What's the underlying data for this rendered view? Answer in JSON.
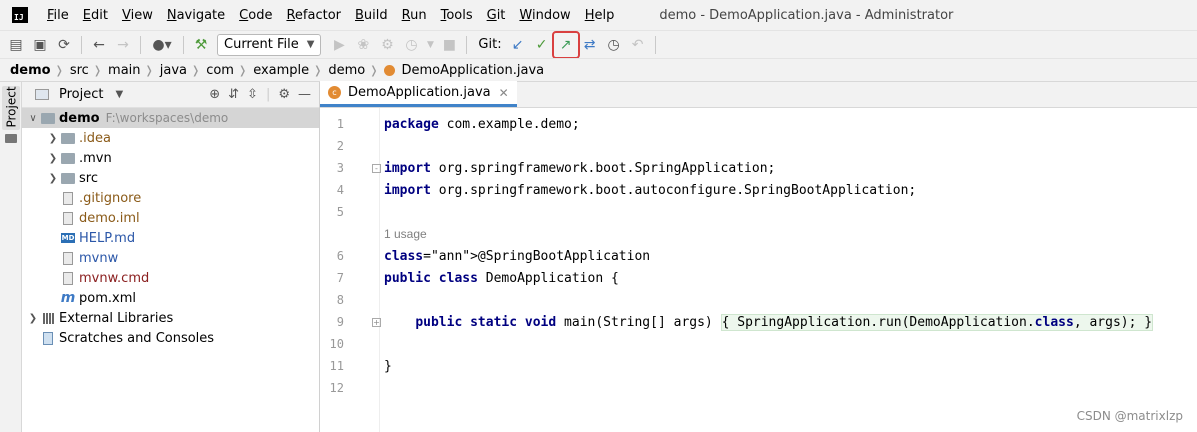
{
  "window": {
    "title": "demo - DemoApplication.java - Administrator"
  },
  "menu": [
    "File",
    "Edit",
    "View",
    "Navigate",
    "Code",
    "Refactor",
    "Build",
    "Run",
    "Tools",
    "Git",
    "Window",
    "Help"
  ],
  "toolbar": {
    "run_config": "Current File",
    "git_label": "Git:"
  },
  "breadcrumbs": [
    "demo",
    "src",
    "main",
    "java",
    "com",
    "example",
    "demo",
    "DemoApplication.java"
  ],
  "side_tabs": {
    "project": "Project"
  },
  "project_panel": {
    "title": "Project",
    "tree": [
      {
        "label": "demo",
        "path": "F:\\workspaces\\demo",
        "level": 0,
        "expanded": true,
        "bold": true,
        "icon": "module-folder"
      },
      {
        "label": ".idea",
        "level": 1,
        "collapsed": true,
        "icon": "folder",
        "color": "#8a5a18"
      },
      {
        "label": ".mvn",
        "level": 1,
        "collapsed": true,
        "icon": "folder",
        "color": "#000000"
      },
      {
        "label": "src",
        "level": 1,
        "collapsed": true,
        "icon": "folder",
        "color": "#000000"
      },
      {
        "label": ".gitignore",
        "level": 1,
        "icon": "file",
        "color": "#8a5a18"
      },
      {
        "label": "demo.iml",
        "level": 1,
        "icon": "file",
        "color": "#8a5a18"
      },
      {
        "label": "HELP.md",
        "level": 1,
        "icon": "md",
        "color": "#2b57a8"
      },
      {
        "label": "mvnw",
        "level": 1,
        "icon": "file",
        "color": "#2b57a8"
      },
      {
        "label": "mvnw.cmd",
        "level": 1,
        "icon": "file",
        "color": "#8b2020"
      },
      {
        "label": "pom.xml",
        "level": 1,
        "icon": "maven",
        "color": "#000000"
      },
      {
        "label": "External Libraries",
        "level": 0,
        "collapsed": true,
        "icon": "libraries",
        "color": "#000000"
      },
      {
        "label": "Scratches and Consoles",
        "level": 0,
        "icon": "scratches",
        "color": "#000000"
      }
    ]
  },
  "editor": {
    "tab": "DemoApplication.java",
    "usage_hint": "1 usage",
    "lines": [
      "package com.example.demo;",
      "",
      "import org.springframework.boot.SpringApplication;",
      "import org.springframework.boot.autoconfigure.SpringBootApplication;",
      "",
      "@SpringBootApplication",
      "public class DemoApplication {",
      "",
      "    public static void main(String[] args) { SpringApplication.run(DemoApplication.class, args); }",
      "",
      "}",
      ""
    ],
    "current_line": 14
  },
  "watermark": "CSDN @matrixlzp"
}
